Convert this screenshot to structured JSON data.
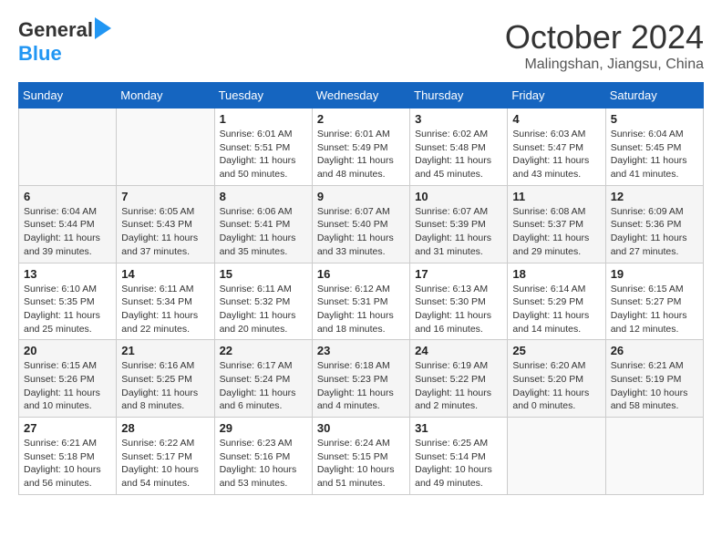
{
  "header": {
    "logo_general": "General",
    "logo_blue": "Blue",
    "month_title": "October 2024",
    "location": "Malingshan, Jiangsu, China"
  },
  "days_of_week": [
    "Sunday",
    "Monday",
    "Tuesday",
    "Wednesday",
    "Thursday",
    "Friday",
    "Saturday"
  ],
  "weeks": [
    [
      {
        "day": "",
        "info": ""
      },
      {
        "day": "",
        "info": ""
      },
      {
        "day": "1",
        "info": "Sunrise: 6:01 AM\nSunset: 5:51 PM\nDaylight: 11 hours and 50 minutes."
      },
      {
        "day": "2",
        "info": "Sunrise: 6:01 AM\nSunset: 5:49 PM\nDaylight: 11 hours and 48 minutes."
      },
      {
        "day": "3",
        "info": "Sunrise: 6:02 AM\nSunset: 5:48 PM\nDaylight: 11 hours and 45 minutes."
      },
      {
        "day": "4",
        "info": "Sunrise: 6:03 AM\nSunset: 5:47 PM\nDaylight: 11 hours and 43 minutes."
      },
      {
        "day": "5",
        "info": "Sunrise: 6:04 AM\nSunset: 5:45 PM\nDaylight: 11 hours and 41 minutes."
      }
    ],
    [
      {
        "day": "6",
        "info": "Sunrise: 6:04 AM\nSunset: 5:44 PM\nDaylight: 11 hours and 39 minutes."
      },
      {
        "day": "7",
        "info": "Sunrise: 6:05 AM\nSunset: 5:43 PM\nDaylight: 11 hours and 37 minutes."
      },
      {
        "day": "8",
        "info": "Sunrise: 6:06 AM\nSunset: 5:41 PM\nDaylight: 11 hours and 35 minutes."
      },
      {
        "day": "9",
        "info": "Sunrise: 6:07 AM\nSunset: 5:40 PM\nDaylight: 11 hours and 33 minutes."
      },
      {
        "day": "10",
        "info": "Sunrise: 6:07 AM\nSunset: 5:39 PM\nDaylight: 11 hours and 31 minutes."
      },
      {
        "day": "11",
        "info": "Sunrise: 6:08 AM\nSunset: 5:37 PM\nDaylight: 11 hours and 29 minutes."
      },
      {
        "day": "12",
        "info": "Sunrise: 6:09 AM\nSunset: 5:36 PM\nDaylight: 11 hours and 27 minutes."
      }
    ],
    [
      {
        "day": "13",
        "info": "Sunrise: 6:10 AM\nSunset: 5:35 PM\nDaylight: 11 hours and 25 minutes."
      },
      {
        "day": "14",
        "info": "Sunrise: 6:11 AM\nSunset: 5:34 PM\nDaylight: 11 hours and 22 minutes."
      },
      {
        "day": "15",
        "info": "Sunrise: 6:11 AM\nSunset: 5:32 PM\nDaylight: 11 hours and 20 minutes."
      },
      {
        "day": "16",
        "info": "Sunrise: 6:12 AM\nSunset: 5:31 PM\nDaylight: 11 hours and 18 minutes."
      },
      {
        "day": "17",
        "info": "Sunrise: 6:13 AM\nSunset: 5:30 PM\nDaylight: 11 hours and 16 minutes."
      },
      {
        "day": "18",
        "info": "Sunrise: 6:14 AM\nSunset: 5:29 PM\nDaylight: 11 hours and 14 minutes."
      },
      {
        "day": "19",
        "info": "Sunrise: 6:15 AM\nSunset: 5:27 PM\nDaylight: 11 hours and 12 minutes."
      }
    ],
    [
      {
        "day": "20",
        "info": "Sunrise: 6:15 AM\nSunset: 5:26 PM\nDaylight: 11 hours and 10 minutes."
      },
      {
        "day": "21",
        "info": "Sunrise: 6:16 AM\nSunset: 5:25 PM\nDaylight: 11 hours and 8 minutes."
      },
      {
        "day": "22",
        "info": "Sunrise: 6:17 AM\nSunset: 5:24 PM\nDaylight: 11 hours and 6 minutes."
      },
      {
        "day": "23",
        "info": "Sunrise: 6:18 AM\nSunset: 5:23 PM\nDaylight: 11 hours and 4 minutes."
      },
      {
        "day": "24",
        "info": "Sunrise: 6:19 AM\nSunset: 5:22 PM\nDaylight: 11 hours and 2 minutes."
      },
      {
        "day": "25",
        "info": "Sunrise: 6:20 AM\nSunset: 5:20 PM\nDaylight: 11 hours and 0 minutes."
      },
      {
        "day": "26",
        "info": "Sunrise: 6:21 AM\nSunset: 5:19 PM\nDaylight: 10 hours and 58 minutes."
      }
    ],
    [
      {
        "day": "27",
        "info": "Sunrise: 6:21 AM\nSunset: 5:18 PM\nDaylight: 10 hours and 56 minutes."
      },
      {
        "day": "28",
        "info": "Sunrise: 6:22 AM\nSunset: 5:17 PM\nDaylight: 10 hours and 54 minutes."
      },
      {
        "day": "29",
        "info": "Sunrise: 6:23 AM\nSunset: 5:16 PM\nDaylight: 10 hours and 53 minutes."
      },
      {
        "day": "30",
        "info": "Sunrise: 6:24 AM\nSunset: 5:15 PM\nDaylight: 10 hours and 51 minutes."
      },
      {
        "day": "31",
        "info": "Sunrise: 6:25 AM\nSunset: 5:14 PM\nDaylight: 10 hours and 49 minutes."
      },
      {
        "day": "",
        "info": ""
      },
      {
        "day": "",
        "info": ""
      }
    ]
  ]
}
